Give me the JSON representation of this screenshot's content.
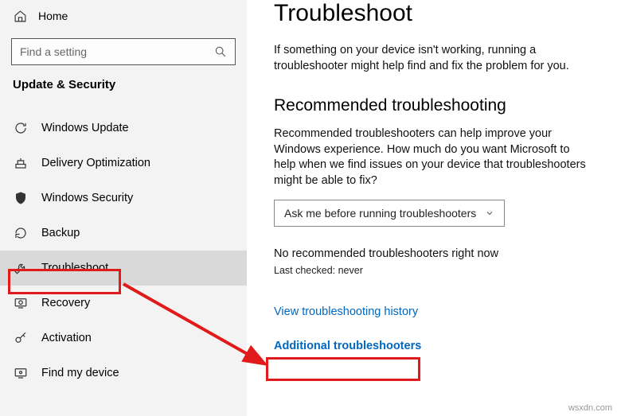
{
  "sidebar": {
    "home_label": "Home",
    "search_placeholder": "Find a setting",
    "section_title": "Update & Security",
    "items": [
      {
        "label": "Windows Update"
      },
      {
        "label": "Delivery Optimization"
      },
      {
        "label": "Windows Security"
      },
      {
        "label": "Backup"
      },
      {
        "label": "Troubleshoot"
      },
      {
        "label": "Recovery"
      },
      {
        "label": "Activation"
      },
      {
        "label": "Find my device"
      }
    ]
  },
  "main": {
    "title": "Troubleshoot",
    "intro": "If something on your device isn't working, running a troubleshooter might help find and fix the problem for you.",
    "recommended_heading": "Recommended troubleshooting",
    "recommended_body": "Recommended troubleshooters can help improve your Windows experience. How much do you want Microsoft to help when we find issues on your device that troubleshooters might be able to fix?",
    "dropdown_value": "Ask me before running troubleshooters",
    "no_recommended": "No recommended troubleshooters right now",
    "last_checked": "Last checked: never",
    "history_link": "View troubleshooting history",
    "additional_link": "Additional troubleshooters"
  },
  "watermark": "wsxdn.com"
}
